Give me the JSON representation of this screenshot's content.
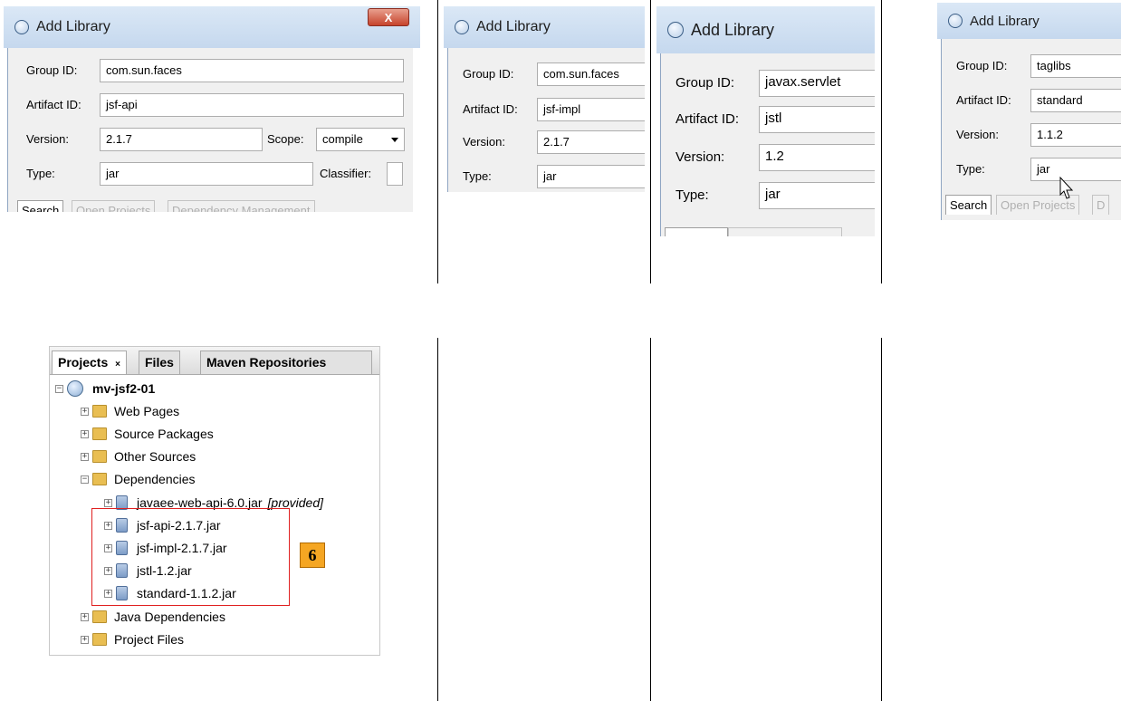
{
  "dialogs": [
    {
      "title": "Add Library",
      "close_label": "X",
      "group_label": "Group ID:",
      "group_value": "com.sun.faces",
      "artifact_label": "Artifact ID:",
      "artifact_value": "jsf-api",
      "version_label": "Version:",
      "version_value": "2.1.7",
      "scope_label": "Scope:",
      "scope_value": "compile",
      "type_label": "Type:",
      "type_value": "jar",
      "classifier_label": "Classifier:",
      "tabs": [
        "Search",
        "Open Projects",
        "Dependency Management"
      ]
    },
    {
      "title": "Add Library",
      "group_label": "Group ID:",
      "group_value": "com.sun.faces",
      "artifact_label": "Artifact ID:",
      "artifact_value": "jsf-impl",
      "version_label": "Version:",
      "version_value": "2.1.7",
      "type_label": "Type:",
      "type_value": "jar"
    },
    {
      "title": "Add Library",
      "group_label": "Group ID:",
      "group_value": "javax.servlet",
      "artifact_label": "Artifact ID:",
      "artifact_value": "jstl",
      "version_label": "Version:",
      "version_value": "1.2",
      "type_label": "Type:",
      "type_value": "jar"
    },
    {
      "title": "Add Library",
      "group_label": "Group ID:",
      "group_value": "taglibs",
      "artifact_label": "Artifact ID:",
      "artifact_value": "standard",
      "version_label": "Version:",
      "version_value": "1.1.2",
      "type_label": "Type:",
      "type_value": "jar",
      "tabs": [
        "Search",
        "Open Projects",
        "D"
      ]
    }
  ],
  "projects": {
    "tabs": [
      "Projects",
      "Files",
      "Maven Repositories"
    ],
    "tab_close": "×",
    "root": "mv-jsf2-01",
    "items": [
      {
        "label": "Web Pages",
        "icon": "folder-web-icon"
      },
      {
        "label": "Source Packages",
        "icon": "folder-package-icon"
      },
      {
        "label": "Other Sources",
        "icon": "folder-sources-icon"
      },
      {
        "label": "Dependencies",
        "icon": "folder-dependencies-icon"
      },
      {
        "label": "Java Dependencies",
        "icon": "folder-dependencies-icon"
      },
      {
        "label": "Project Files",
        "icon": "folder-files-icon"
      }
    ],
    "jars": [
      {
        "label": "javaee-web-api-6.0.jar",
        "tag": "[provided]"
      },
      {
        "label": "jsf-api-2.1.7.jar"
      },
      {
        "label": "jsf-impl-2.1.7.jar"
      },
      {
        "label": "jstl-1.2.jar"
      },
      {
        "label": "standard-1.1.2.jar"
      }
    ],
    "expand": "+",
    "collapse": "−"
  },
  "step_badge": "6"
}
